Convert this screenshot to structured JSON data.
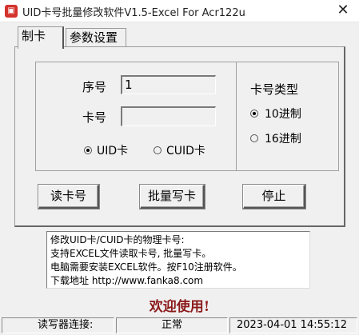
{
  "window": {
    "title": "UID卡号批量修改软件V1.5-Excel For Acr122u",
    "close_glyph": "✕"
  },
  "tabs": [
    {
      "label": "制卡",
      "active": true
    },
    {
      "label": "参数设置",
      "active": false
    }
  ],
  "form": {
    "serial_label": "序号",
    "serial_value": "1",
    "card_label": "卡号",
    "card_value": "",
    "card_kind_options": [
      {
        "label": "UID卡",
        "checked": true
      },
      {
        "label": "CUID卡",
        "checked": false
      }
    ]
  },
  "card_type": {
    "title": "卡号类型",
    "options": [
      {
        "label": "10进制",
        "checked": true
      },
      {
        "label": "16进制",
        "checked": false
      }
    ]
  },
  "buttons": {
    "read": "读卡号",
    "batch_write": "批量写卡",
    "stop": "停止"
  },
  "info": {
    "lines": [
      "修改UID卡/CUID卡的物理卡号:",
      "支持EXCEL文件读取卡号, 批量写卡。",
      "电脑需要安装EXCEL软件。按F10注册软件。",
      "下载地址 http://www.fanka8.com"
    ]
  },
  "welcome": "欢迎使用!",
  "statusbar": {
    "reader_label": "读写器连接:",
    "status": "正常",
    "datetime": "2023-04-01 14:55:12"
  },
  "colors": {
    "welcome": "#8b1a1a",
    "window_bg": "#f0f0f0"
  }
}
